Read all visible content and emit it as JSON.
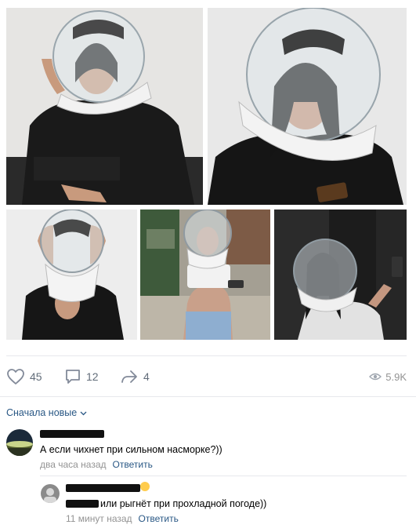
{
  "post": {
    "photos": [
      {
        "name": "photo-1",
        "alt": ""
      },
      {
        "name": "photo-2",
        "alt": ""
      },
      {
        "name": "photo-3",
        "alt": ""
      },
      {
        "name": "photo-4",
        "alt": ""
      },
      {
        "name": "photo-5",
        "alt": ""
      }
    ],
    "actions": {
      "likes": "45",
      "comments": "12",
      "shares": "4",
      "views": "5.9K",
      "like_icon": "heart-icon",
      "comment_icon": "comment-icon",
      "share_icon": "share-arrow-icon",
      "views_icon": "eye-icon"
    }
  },
  "comments_section": {
    "sort_label": "Сначала новые",
    "comments": [
      {
        "text": "А если чихнет при сильном насморке?))",
        "time": "два часа назад",
        "reply_label": "Ответить"
      },
      {
        "text": "или рыгнёт при прохладной погоде))",
        "time": "11 минут назад",
        "reply_label": "Ответить"
      }
    ]
  },
  "colors": {
    "link": "#2a5885",
    "meta": "#939393",
    "icon": "#626d7a",
    "divider": "#e7e8ec"
  }
}
